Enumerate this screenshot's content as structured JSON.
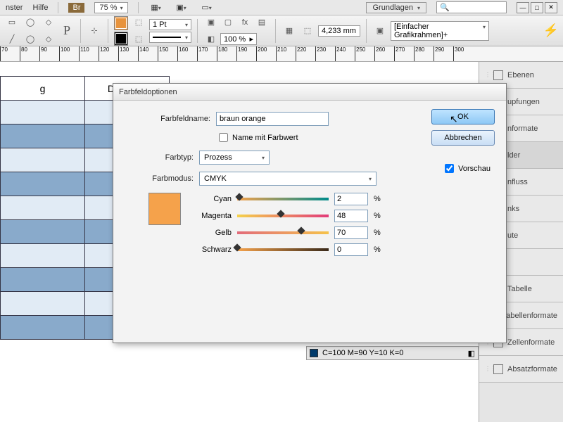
{
  "menu": {
    "items": [
      "nster",
      "Hilfe"
    ],
    "br_label": "Br",
    "zoom": "75 %",
    "workspace": "Grundlagen"
  },
  "toolbar": {
    "stroke": "1 Pt",
    "opacity": "100 %",
    "measure": "4,233 mm",
    "grafik": "[Einfacher Grafikrahmen]+"
  },
  "ruler_marks": [
    70,
    80,
    90,
    100,
    110,
    120,
    130,
    140,
    150,
    160,
    170,
    180,
    190,
    200,
    210,
    220,
    230,
    240,
    250,
    260,
    270,
    280,
    290,
    300
  ],
  "table": {
    "headers": [
      "g",
      "Dienstag"
    ]
  },
  "swatch_footer": "C=100 M=90 Y=10 K=0",
  "panels": [
    "Ebenen",
    "upfungen",
    "nformate",
    "lder",
    "nfluss",
    "nks",
    "ute",
    "",
    "Tabelle",
    "Tabellenformate",
    "Zellenformate",
    "Absatzformate"
  ],
  "dialog": {
    "title": "Farbfeldoptionen",
    "name_label": "Farbfeldname:",
    "name_value": "braun orange",
    "name_with_value": "Name mit Farbwert",
    "type_label": "Farbtyp:",
    "type_value": "Prozess",
    "mode_label": "Farbmodus:",
    "mode_value": "CMYK",
    "ok": "OK",
    "cancel": "Abbrechen",
    "preview": "Vorschau",
    "channels": [
      {
        "label": "Cyan",
        "value": "2",
        "pos": 2,
        "grad": "linear-gradient(90deg,#f5a24b,#008b8b)"
      },
      {
        "label": "Magenta",
        "value": "48",
        "pos": 48,
        "grad": "linear-gradient(90deg,#f5d24b,#e23b7a)"
      },
      {
        "label": "Gelb",
        "value": "70",
        "pos": 70,
        "grad": "linear-gradient(90deg,#e26b7a,#f5c24b)"
      },
      {
        "label": "Schwarz",
        "value": "0",
        "pos": 0,
        "grad": "linear-gradient(90deg,#f5a24b,#3a2a1a)"
      }
    ]
  }
}
